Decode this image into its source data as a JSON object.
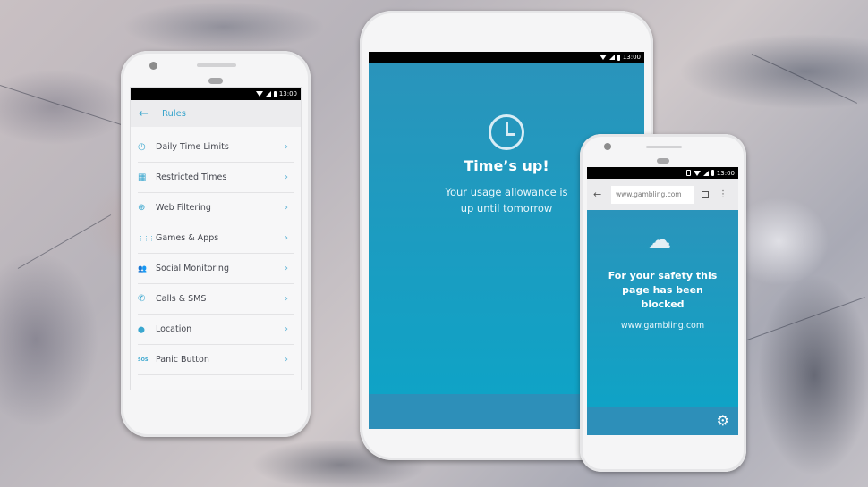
{
  "status_time": "13:00",
  "rules_phone": {
    "header": {
      "back_icon": "arrow-left-icon",
      "title": "Rules"
    },
    "items": [
      {
        "label": "Daily Time Limits",
        "icon": "clock-icon",
        "glyph": "◷"
      },
      {
        "label": "Restricted Times",
        "icon": "calendar-icon",
        "glyph": "▦"
      },
      {
        "label": "Web Filtering",
        "icon": "globe-icon",
        "glyph": "⊕"
      },
      {
        "label": "Games & Apps",
        "icon": "apps-grid-icon",
        "glyph": "⋮⋮⋮"
      },
      {
        "label": "Social Monitoring",
        "icon": "people-icon",
        "glyph": "👥"
      },
      {
        "label": "Calls & SMS",
        "icon": "phone-icon",
        "glyph": "✆"
      },
      {
        "label": "Location",
        "icon": "location-pin-icon",
        "glyph": "⬤"
      },
      {
        "label": "Panic Button",
        "icon": "sos-icon",
        "glyph": "SOS"
      }
    ],
    "chevron": "›"
  },
  "tablet": {
    "icon": "clock-icon",
    "title": "Time’s up!",
    "message": "Your usage allowance is up until tomorrow"
  },
  "browser_phone": {
    "url": "www.gambling.com",
    "blocked_title": "For your safety this page has been blocked",
    "blocked_url": "www.gambling.com",
    "icon": "cloud-icon",
    "settings_icon": "gear-icon"
  },
  "colors": {
    "accent": "#37a4cc",
    "screen_blue": "#1a9cc2",
    "footer_blue": "#2d8fb9"
  }
}
